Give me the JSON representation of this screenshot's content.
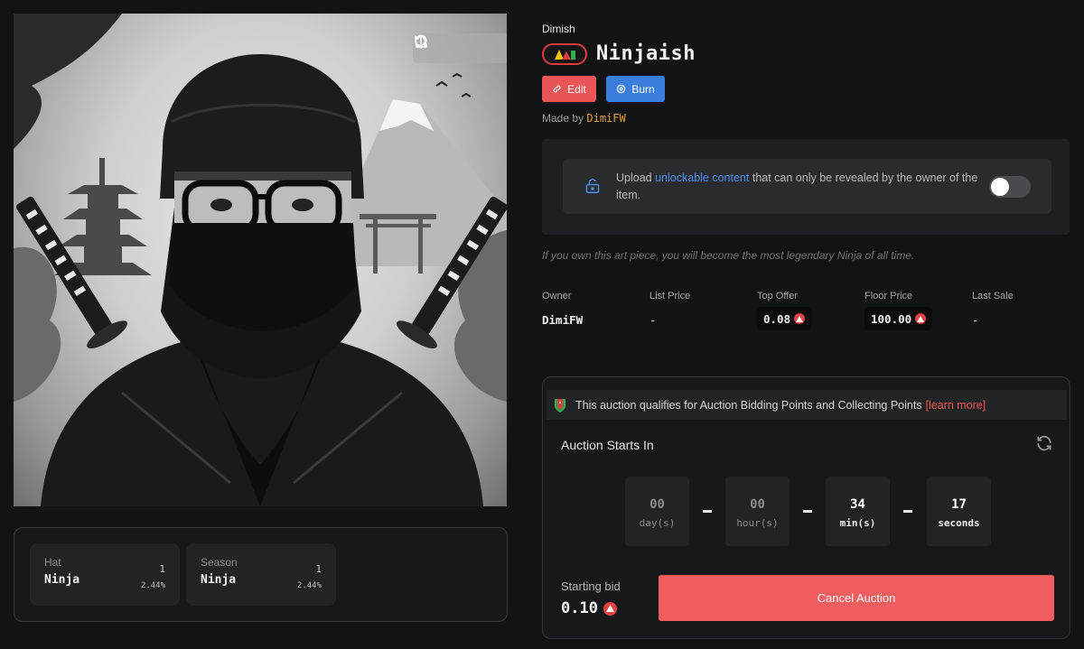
{
  "artwork": {
    "tools": [
      {
        "icon": "refresh-icon"
      },
      {
        "icon": "zoom-icon"
      },
      {
        "icon": "share-icon"
      }
    ]
  },
  "traits": [
    {
      "name": "Hat",
      "value": "Ninja",
      "count": "1",
      "percent": "2.44%"
    },
    {
      "name": "Season",
      "value": "Ninja",
      "count": "1",
      "percent": "2.44%"
    }
  ],
  "item": {
    "collection": "Dimish",
    "title": "Ninjaish",
    "edit_label": "Edit",
    "burn_label": "Burn",
    "made_by_prefix": "Made by",
    "creator": "DimiFW",
    "description": "If you own this art piece, you will become the most legendary Ninja of all time."
  },
  "unlockable": {
    "text_before": "Upload",
    "link": "unlockable content",
    "text_after": "that can only be revealed by the owner of the item.",
    "enabled": false
  },
  "stats": {
    "owner_label": "Owner",
    "owner": "DimiFW",
    "list_label": "List Price",
    "list": "-",
    "top_offer_label": "Top Offer",
    "top_offer": "0.08",
    "floor_label": "Floor Price",
    "floor": "100.00",
    "last_sale_label": "Last Sale",
    "last_sale": "-"
  },
  "auction": {
    "qualifies_text": "This auction qualifies for Auction Bidding Points and Collecting Points",
    "learn_more": "[learn more]",
    "starts_label": "Auction Starts In",
    "countdown": [
      {
        "value": "00",
        "unit": "day(s)"
      },
      {
        "value": "00",
        "unit": "hour(s)"
      },
      {
        "value": "34",
        "unit": "min(s)"
      },
      {
        "value": "17",
        "unit": "seconds"
      }
    ],
    "starting_bid_label": "Starting bid",
    "starting_bid": "0.10",
    "cancel_label": "Cancel Auction"
  },
  "colors": {
    "accent_red": "#f05d5f",
    "accent_blue": "#3b7ddd",
    "creator_orange": "#e9a23b",
    "avax_red": "#e84142"
  }
}
